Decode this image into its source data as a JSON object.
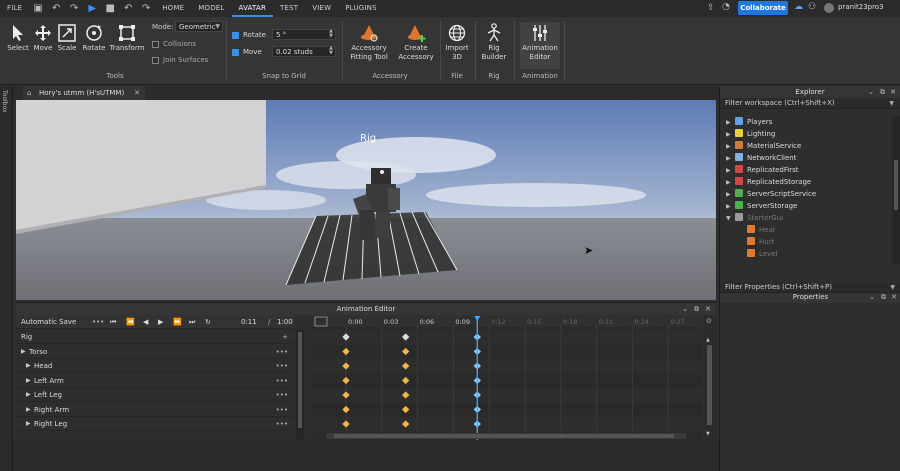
{
  "menu": {
    "items": [
      "FILE",
      "HOME",
      "MODEL",
      "AVATAR",
      "TEST",
      "VIEW",
      "PLUGINS"
    ],
    "active": "AVATAR"
  },
  "topbar": {
    "collaborate": "Collaborate",
    "user": "pranit23pro3"
  },
  "ribbon": {
    "tools": {
      "select": "Select",
      "move": "Move",
      "scale": "Scale",
      "rotate": "Rotate",
      "transform": "Transform",
      "group": "Tools",
      "mode_label": "Mode:",
      "mode_value": "Geometric",
      "collisions": "Collisions",
      "join_surfaces": "Join Surfaces"
    },
    "snap": {
      "rotate_label": "Rotate",
      "rotate_value": "5 °",
      "move_label": "Move",
      "move_value": "0.02 studs",
      "group": "Snap to Grid"
    },
    "accessory": {
      "fitting_l1": "Accessory",
      "fitting_l2": "Fitting Tool",
      "create_l1": "Create",
      "create_l2": "Accessory",
      "group": "Accessory"
    },
    "file": {
      "import_l1": "Import",
      "import_l2": "3D",
      "group": "File"
    },
    "rig": {
      "builder_l1": "Rig",
      "builder_l2": "Builder",
      "group": "Rig"
    },
    "animation": {
      "editor_l1": "Animation",
      "editor_l2": "Editor",
      "group": "Animation"
    }
  },
  "leftstrip": {
    "label": "Toolbox"
  },
  "document": {
    "tab": "Hory's utmm (H'sUTMM)"
  },
  "viewport": {
    "rig_label": "Rig"
  },
  "animation_editor": {
    "title": "Animation Editor",
    "autosave": "Automatic Save",
    "current_time": "0:11",
    "separator": "/",
    "total_time": "1:00",
    "ticks": [
      "0:00",
      "0:03",
      "0:06",
      "0:09",
      "0:12",
      "0:15",
      "0:18",
      "0:21",
      "0:24",
      "0:27",
      "1:00"
    ],
    "playhead_tick": "0:11",
    "tracks": [
      {
        "label": "Rig",
        "level": 0
      },
      {
        "label": "Torso",
        "level": 0
      },
      {
        "label": "Head",
        "level": 1
      },
      {
        "label": "Left Arm",
        "level": 1
      },
      {
        "label": "Left Leg",
        "level": 1
      },
      {
        "label": "Right Arm",
        "level": 1
      },
      {
        "label": "Right Leg",
        "level": 1
      }
    ],
    "keyframe_ticks": [
      "0:00",
      "0:05",
      "0:11"
    ]
  },
  "explorer": {
    "title": "Explorer",
    "filter": "Filter workspace (Ctrl+Shift+X)",
    "items": [
      {
        "label": "Players",
        "icon_color": "#5fa3e6"
      },
      {
        "label": "Lighting",
        "icon_color": "#e8d23c"
      },
      {
        "label": "MaterialService",
        "icon_color": "#d07b3a"
      },
      {
        "label": "NetworkClient",
        "icon_color": "#7fb0e0"
      },
      {
        "label": "ReplicatedFirst",
        "icon_color": "#d64545"
      },
      {
        "label": "ReplicatedStorage",
        "icon_color": "#d64545"
      },
      {
        "label": "ServerScriptService",
        "icon_color": "#4fb04f"
      },
      {
        "label": "ServerStorage",
        "icon_color": "#4fb04f"
      },
      {
        "label": "StarterGui",
        "icon_color": "#9a9a9a"
      },
      {
        "label": "Heal",
        "icon_color": "#e07a30"
      },
      {
        "label": "Hurt",
        "icon_color": "#e07a30"
      },
      {
        "label": "Level",
        "icon_color": "#e07a30"
      }
    ]
  },
  "properties": {
    "title": "Properties",
    "filter": "Filter Properties (Ctrl+Shift+P)"
  }
}
